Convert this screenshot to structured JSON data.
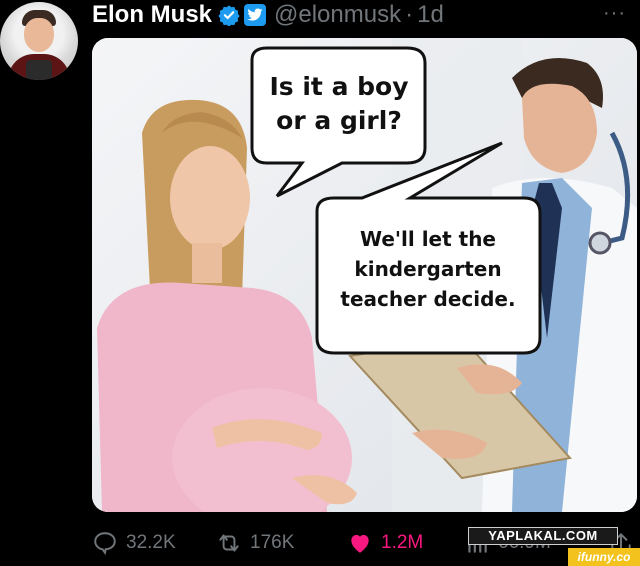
{
  "tweet": {
    "author_name": "Elon Musk",
    "handle": "@elonmusk",
    "separator": "·",
    "time": "1d",
    "more_label": "···"
  },
  "meme": {
    "bubble_1": "Is it a boy or a girl?",
    "bubble_2": "We'll let the kindergarten teacher decide."
  },
  "actions": {
    "replies": "32.2K",
    "reposts": "176K",
    "likes": "1.2M",
    "views": "66.9M"
  },
  "watermarks": {
    "site_1": "YAPLAKAL.COM",
    "site_2": "ifunny.co"
  },
  "colors": {
    "background": "#000000",
    "like": "#f91880",
    "verified": "#1d9bf0",
    "muted": "#71767b"
  },
  "icons": [
    "verified-check-icon",
    "twitter-badge-icon",
    "more-icon",
    "reply-icon",
    "retweet-icon",
    "heart-icon",
    "views-icon",
    "share-icon"
  ]
}
